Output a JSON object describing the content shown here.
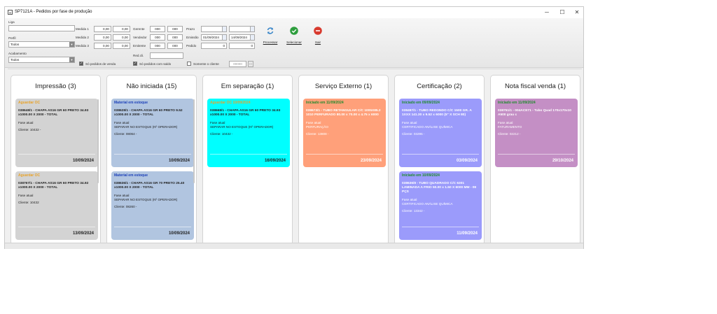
{
  "window": {
    "title": "SP7121A - Pedidos por fase de produção"
  },
  "controls": {
    "minimize": "─",
    "maximize": "☐",
    "close": "✕"
  },
  "filters": {
    "liga_label": "Liga",
    "liga_value": "",
    "perfil_label": "Perfil",
    "perfil_value": "Todos",
    "acabamento_label": "Acabamento",
    "acabamento_value": "Todos",
    "medida1_label": "Medida 1",
    "medida1_from": "0,00",
    "medida1_to": "0,00",
    "medida2_label": "Medida 2",
    "medida2_from": "0,00",
    "medida2_to": "0,00",
    "medida3_label": "Medida 3",
    "medida3_from": "0,00",
    "medida3_to": "0,00",
    "gerente_label": "Gerente",
    "gerente_from": "000",
    "gerente_to": "000",
    "vendedor_label": "Vendedor",
    "vendedor_from": "000",
    "vendedor_to": "000",
    "emitente_label": "Emitente",
    "emitente_from": "000",
    "emitente_to": "000",
    "prazo_label": "Prazo",
    "prazo_from": "",
    "prazo_to": "",
    "emissao_label": "Emissão",
    "emissao_from": "01/09/2024",
    "emissao_to": "14/09/2024",
    "pedido_label": "Pedido",
    "pedido_from": "0",
    "pedido_to": "0",
    "redcli_label": "Red.cli.",
    "redcli_value": "",
    "so_venda_label": "Só pedidos de venda",
    "so_saldo_label": "Só pedidos com saldo",
    "somente_cliente_label": "Somente o cliente",
    "cliente_value": "00000",
    "dots": "..."
  },
  "toolbar": {
    "processar": "Processar",
    "selecionar": "Selecionar",
    "sair": "Sair"
  },
  "colors": {
    "cinza": "#d3d3d3",
    "azul": "#b1c5e0",
    "ciano": "#00ffff",
    "laranja": "#ffa07a",
    "roxo": "#9b9bfb",
    "lilas": "#c48fc5",
    "refresh": "#3b87c9",
    "ok": "#2e9e3e",
    "exit": "#d83a2e"
  },
  "columns": [
    {
      "title": "Impressão (3)",
      "cards": [
        {
          "status": "Aguardar OC",
          "desc": "038648/1 - CHAPA AS16 GR 60 PRETO 34.93 x1000.00 X 2000 - TOTAL",
          "fase_label": "Fase atual",
          "fase_value": "",
          "cliente": "Cliente: 10432 -",
          "date": "10/09/2024"
        },
        {
          "status": "Aguardar OC",
          "desc": "038767/1 - CHAPA AS16 GR 60 PRETO 34.92 x1000.00 X 2000 - TOTAL",
          "fase_label": "Fase atual",
          "fase_value": "",
          "cliente": "Cliente: 10432",
          "date": "13/09/2024"
        }
      ]
    },
    {
      "title": "Não iniciada (15)",
      "cards": [
        {
          "status": "Material em estoque",
          "desc": "038628/1 - CHAPA AS16 GR 60 PRETO 9.52 x1000.00 X 2000 - TOTAL",
          "fase_label": "Fase atual",
          "fase_value": "SEPARAR NO ESTOQUE (Nº OPERADOR)",
          "cliente": "Cliente: 08064 -",
          "date": "10/09/2024"
        },
        {
          "status": "Material em estoque",
          "desc": "038636/1 - CHAPA AS16 GR 70 PRETO 25.40 x1000.00 X 2000 - TOTAL",
          "fase_label": "Fase atual",
          "fase_value": "SEPARAR NO ESTOQUE (Nº OPERADOR)",
          "cliente": "Cliente: 08260 -",
          "date": "10/09/2024"
        }
      ]
    },
    {
      "title": "Em separação (1)",
      "cards": [
        {
          "status": "Aguardar OC 10/09/2024",
          "desc": "038668/1 - CHAPA AS16 GR 60 PRETO 34.93 x1000.00 X 2000 - TOTAL",
          "fase_label": "Fase atual",
          "fase_value": "SEPARAR NO ESTOQUE (Nº OPERADOR)",
          "cliente": "Cliente: 10432 -",
          "date": "16/09/2024"
        }
      ]
    },
    {
      "title": "Serviço Externo (1)",
      "cards": [
        {
          "status": "Iniciado em 11/09/2024",
          "desc": "038673/1 - TUBO RETANGULAR C/C 1005X85.2 1010 PERFURADO 80.00 x 70.00 x 4.75 x 6000",
          "fase_label": "Fase atual",
          "fase_value": "PERFURAÇÃO",
          "cliente": "Cliente: 13808 -",
          "date": "23/09/2024"
        }
      ]
    },
    {
      "title": "Certificação (2)",
      "cards": [
        {
          "status": "Iniciado em 09/09/2024",
          "desc": "038497/1 - TUBO REDONDO C/C 1500 GR. A 1XXX 141.30 x 9.52 x 6000 (5\" X SCH 80)",
          "fase_label": "Fase atual",
          "fase_value": "CERTIFICADO ANÁLISE QUÍMICA",
          "cliente": "Cliente: 03295 -",
          "date": "03/09/2024"
        },
        {
          "status": "Iniciado em 10/09/2024",
          "desc": "038636/8 - TUBO QUADRADO C/C 6301 LAMINADA A FRIO 50.00 x 1.50 X 6000 MM - 08 PÇS",
          "fase_label": "Fase atual",
          "fase_value": "CERTIFICADO ANÁLISE QUÍMICA",
          "cliente": "Cliente: 13342 -",
          "date": "11/09/2024"
        }
      ]
    },
    {
      "title": "Nota fiscal venda (1)",
      "cards": [
        {
          "status": "Iniciado em 11/09/2024",
          "desc": "038751/1 - 004ACE71 - Tubo Quad 170x170x10 A500 grau c",
          "fase_label": "Fase atual",
          "fase_value": "FATURAMENTO",
          "cliente": "Cliente: 02212 -",
          "date": "29/10/2024"
        }
      ]
    }
  ]
}
